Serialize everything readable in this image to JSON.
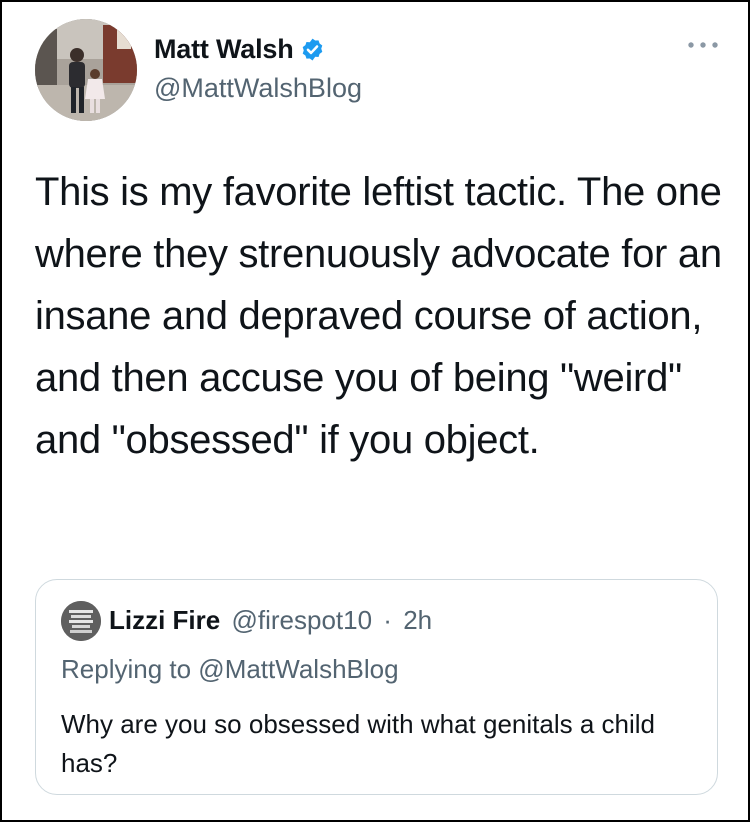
{
  "tweet": {
    "author_name": "Matt Walsh",
    "author_handle": "@MattWalshBlog",
    "text": "This is my favorite leftist tactic. The one where they strenuously advocate for an insane and depraved course of action, and then accuse you of being \"weird\" and \"obsessed\" if you object.",
    "verified_icon": "verified-badge-icon",
    "more_icon": "more-options-icon"
  },
  "quoted_tweet": {
    "author_name": "Lizzi Fire",
    "author_handle": "@firespot10",
    "separator": "·",
    "time": "2h",
    "replying_to": "Replying to @MattWalshBlog",
    "text": "Why are you so obsessed with what genitals a child has?"
  },
  "colors": {
    "text": "#0f1419",
    "secondary": "#536471",
    "verified": "#1d9bf0",
    "border": "#cfd9de"
  }
}
